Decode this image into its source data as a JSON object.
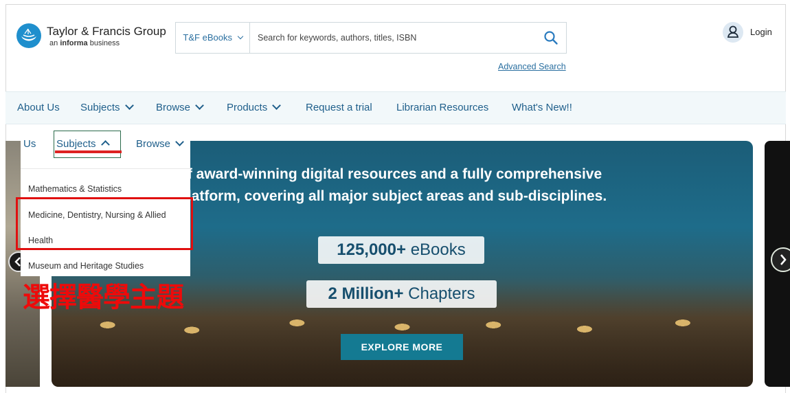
{
  "header": {
    "brand_name": "Taylor & Francis Group",
    "brand_sub_prefix": "an",
    "brand_sub_bold": "informa",
    "brand_sub_suffix": "business",
    "search_scope": "T&F eBooks",
    "search_placeholder": "Search for keywords, authors, titles, ISBN",
    "advanced_search": "Advanced Search",
    "login": "Login"
  },
  "nav": {
    "items": [
      {
        "label": "About Us"
      },
      {
        "label": "Subjects"
      },
      {
        "label": "Browse"
      },
      {
        "label": "Products"
      },
      {
        "label": "Request a trial"
      },
      {
        "label": "Librarian Resources"
      },
      {
        "label": "What's New!!"
      }
    ]
  },
  "dropdown": {
    "tabs": [
      {
        "label": "Us"
      },
      {
        "label": "Subjects"
      },
      {
        "label": "Browse"
      }
    ],
    "items": [
      {
        "label": "Mathematics & Statistics"
      },
      {
        "label": "Medicine, Dentistry, Nursing & Allied"
      },
      {
        "label": "Health"
      },
      {
        "label": "Museum and Heritage Studies"
      }
    ]
  },
  "hero": {
    "line1": "of award-winning digital resources and a fully comprehensive",
    "line2": "platform, covering all major subject areas and sub-disciplines.",
    "pill1_bold": "125,000+",
    "pill1_text": " eBooks",
    "pill2_bold": "2 Million+",
    "pill2_text": " Chapters",
    "cta": "EXPLORE MORE"
  },
  "annotation": {
    "text": "選擇醫學主題",
    "color": "#ee0a0a"
  },
  "colors": {
    "brand_blue": "#1f8fcd",
    "link_blue": "#2a6fa0",
    "nav_text": "#1f5f8b",
    "nav_bg": "#f2f8fa",
    "cta_bg": "#147a92",
    "highlight_red": "#e01010"
  },
  "icons": {
    "logo": "taylor-francis-logo-icon",
    "search": "search-icon",
    "login": "user-icon",
    "prev": "chevron-left-icon",
    "next": "chevron-right-icon"
  }
}
